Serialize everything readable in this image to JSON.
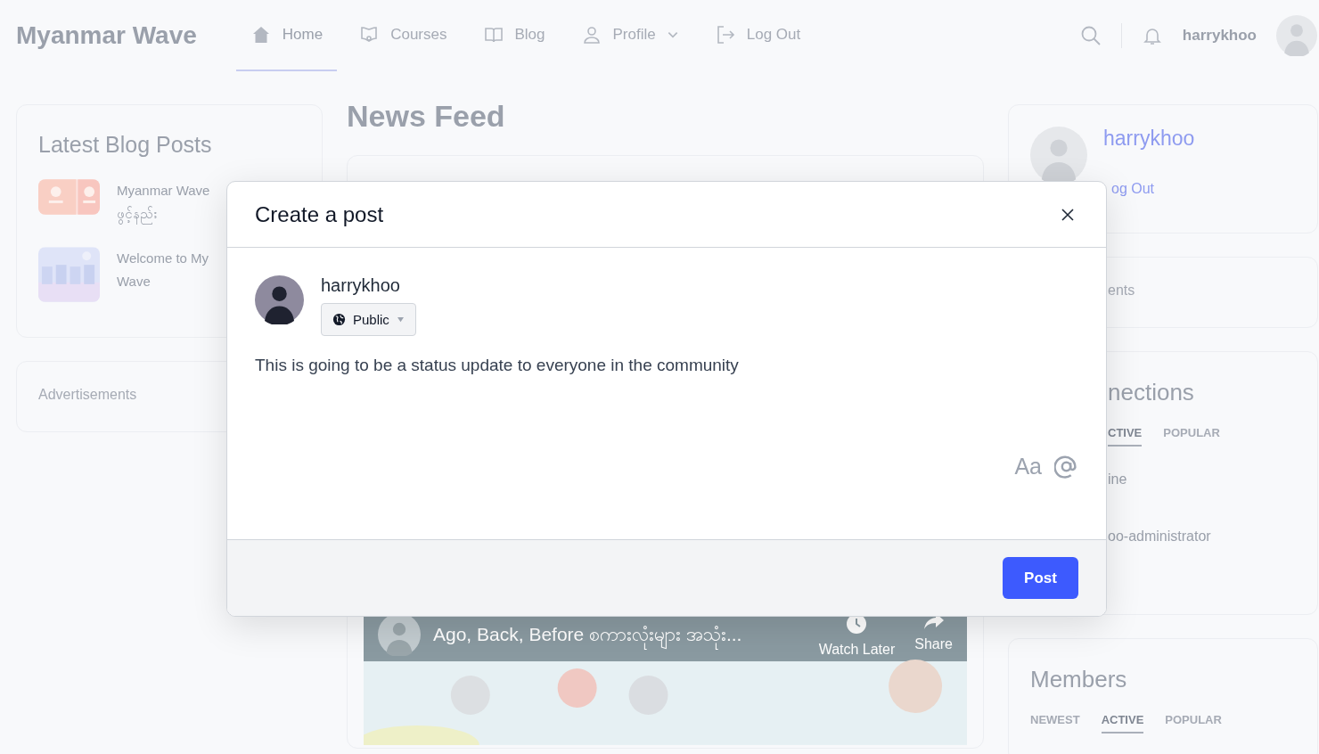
{
  "navbar": {
    "brand": "Myanmar Wave",
    "items": [
      {
        "label": "Home",
        "kind": "link",
        "selected": true
      },
      {
        "label": "Courses",
        "kind": "link",
        "selected": false
      },
      {
        "label": "Blog",
        "kind": "link",
        "selected": false
      },
      {
        "label": "Profile",
        "kind": "dropdown",
        "selected": false
      },
      {
        "label": "Log Out",
        "kind": "link",
        "selected": false
      }
    ],
    "user_name": "harrykhoo"
  },
  "left": {
    "blog_card": {
      "title": "Latest Blog Posts",
      "posts": [
        {
          "title_lines": [
            "Myanmar Wave",
            "ဖွင့်နည်း"
          ]
        },
        {
          "title_lines": [
            "Welcome to My",
            "Wave"
          ]
        }
      ]
    },
    "ads_card": {
      "title": "Advertisements"
    }
  },
  "feed": {
    "title": "News Feed",
    "video": {
      "title": "Ago, Back, Before စကားလုံးများ အသုံး...",
      "actions": [
        {
          "label": "Watch Later"
        },
        {
          "label": "Share"
        }
      ]
    }
  },
  "right": {
    "profile": {
      "name": "harrykhoo",
      "link": "og Out"
    },
    "card_2": {
      "text": "ents"
    },
    "connections": {
      "title": "nections",
      "tabs": [
        {
          "label": "CTIVE",
          "selected": true
        },
        {
          "label": "POPULAR",
          "selected": false
        }
      ],
      "items": [
        "ine",
        "oo-administrator"
      ]
    },
    "members": {
      "title": "Members",
      "tabs": [
        {
          "label": "NEWEST",
          "selected": false
        },
        {
          "label": "ACTIVE",
          "selected": true
        },
        {
          "label": "POPULAR",
          "selected": false
        }
      ]
    }
  },
  "modal": {
    "title": "Create a post",
    "author": "harrykhoo",
    "audience": "Public",
    "text": "This is going to be a status update to everyone in the community",
    "tools": [
      "Aa"
    ],
    "button": "Post"
  }
}
